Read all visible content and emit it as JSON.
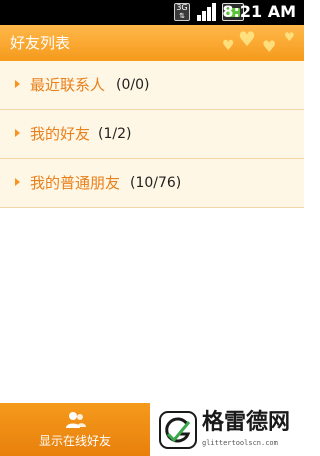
{
  "status_bar": {
    "network_label": "3G",
    "time": "8:21",
    "ampm": "AM"
  },
  "header": {
    "title": "好友列表"
  },
  "groups": [
    {
      "name": "最近联系人",
      "count": "(0/0)"
    },
    {
      "name": "我的好友",
      "count": "(1/2)"
    },
    {
      "name": "我的普通朋友",
      "count": "(10/76)"
    }
  ],
  "bottom_bar": {
    "online_tab_label": "显示在线好友",
    "online_tab_icon": "users-icon"
  },
  "watermark": {
    "brand": "格雷德网",
    "url": "glittertoolscn.com"
  },
  "colors": {
    "header": "#f7a02c",
    "row_bg": "#fff7e6",
    "group_name": "#e8801b",
    "arrow": "#f7941d"
  }
}
